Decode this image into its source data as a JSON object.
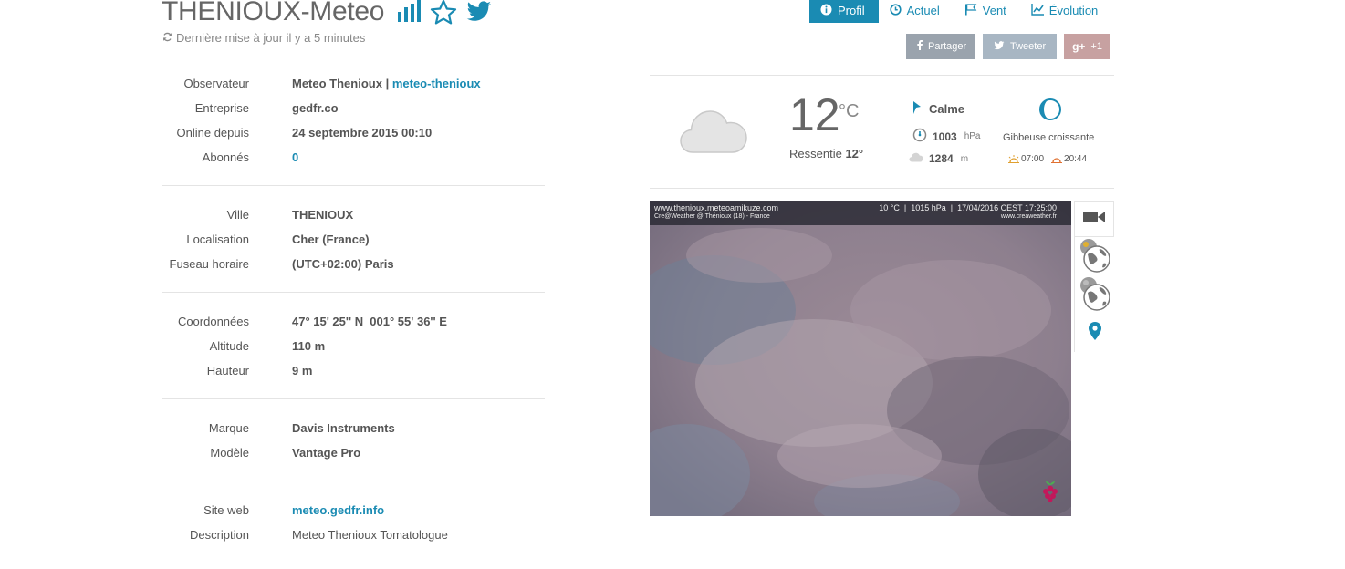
{
  "header": {
    "title": "THENIOUX-Meteo",
    "updated": "Dernière mise à jour il y a 5 minutes"
  },
  "tabs": [
    {
      "label": "Profil",
      "icon": "info-icon",
      "active": true
    },
    {
      "label": "Actuel",
      "icon": "clock-icon",
      "active": false
    },
    {
      "label": "Vent",
      "icon": "flag-icon",
      "active": false
    },
    {
      "label": "Évolution",
      "icon": "chart-icon",
      "active": false
    }
  ],
  "share": {
    "facebook": "Partager",
    "twitter": "Tweeter",
    "gplus": "+1"
  },
  "info": {
    "observer_label": "Observateur",
    "observer_name": "Meteo Thenioux",
    "observer_sep": " | ",
    "observer_handle": "meteo-thenioux",
    "company_label": "Entreprise",
    "company": "gedfr.co",
    "online_label": "Online depuis",
    "online": "24 septembre 2015 00:10",
    "subs_label": "Abonnés",
    "subs": "0",
    "city_label": "Ville",
    "city": "THENIOUX",
    "loc_label": "Localisation",
    "loc": "Cher (France)",
    "tz_label": "Fuseau horaire",
    "tz": "(UTC+02:00) Paris",
    "coord_label": "Coordonnées",
    "coord": "47° 15' 25'' N  001° 55' 36'' E",
    "alt_label": "Altitude",
    "alt": "110 m",
    "height_label": "Hauteur",
    "height": "9 m",
    "brand_label": "Marque",
    "brand": "Davis Instruments",
    "model_label": "Modèle",
    "model": "Vantage Pro",
    "web_label": "Site web",
    "web": "meteo.gedfr.info",
    "desc_label": "Description",
    "desc": "Meteo Thenioux Tomatologue"
  },
  "weather": {
    "temp": "12",
    "unit": "°C",
    "feels_label": "Ressentie",
    "feels": "12°",
    "wind": "Calme",
    "pressure": "1003",
    "pressure_unit": "hPa",
    "cloud_base": "1284",
    "cloud_base_unit": "m",
    "moon": "Gibbeuse croissante",
    "sunrise": "07:00",
    "sunset": "20:44"
  },
  "webcam": {
    "url": "www.thenioux.meteoamikuze.com",
    "caption": "Cre@Weather @ Thénioux (18) - France",
    "stats": "10 °C  |  1015 hPa  |  17/04/2016 CEST 17:25:00",
    "credit": "www.creaweather.fr"
  },
  "colors": {
    "accent": "#1a8bb3",
    "text": "#555555"
  }
}
